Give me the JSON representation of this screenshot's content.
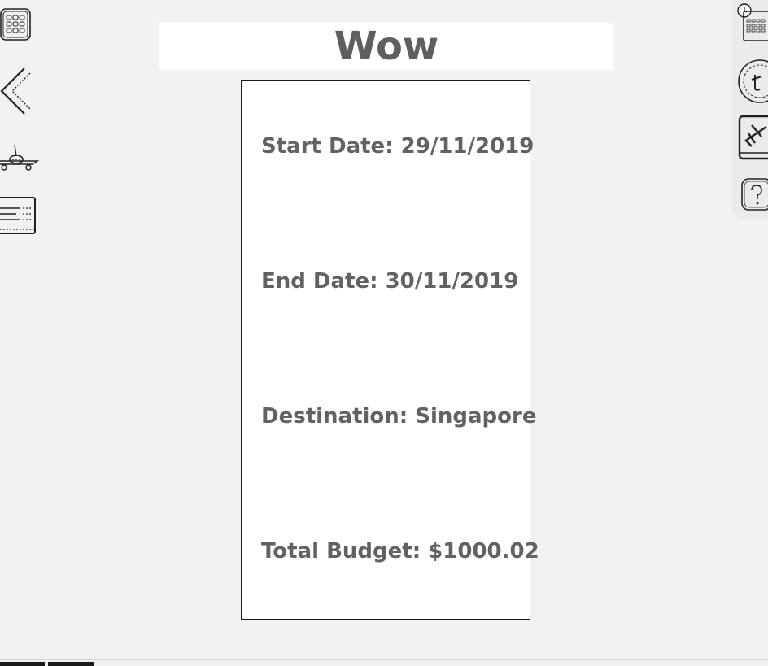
{
  "page": {
    "title": "Wow"
  },
  "trip": {
    "start_date_text": "Start Date: 29/11/2019",
    "end_date_text": "End Date: 30/11/2019",
    "destination_text": "Destination: Singapore",
    "total_budget_text": "Total Budget: $1000.02"
  },
  "left_nav": {
    "items": [
      {
        "icon": "grid-menu-icon"
      },
      {
        "icon": "back-chevron-icon"
      },
      {
        "icon": "airplane-icon"
      },
      {
        "icon": "list-document-icon"
      }
    ]
  },
  "right_nav": {
    "items": [
      {
        "icon": "calendar-clock-icon"
      },
      {
        "icon": "currency-coin-icon"
      },
      {
        "icon": "flight-book-icon"
      },
      {
        "icon": "help-question-icon"
      }
    ]
  },
  "colors": {
    "background": "#f2f2f2",
    "title_text": "#5f5f5f",
    "field_text": "#626262",
    "card_border": "#1a1a1a"
  }
}
